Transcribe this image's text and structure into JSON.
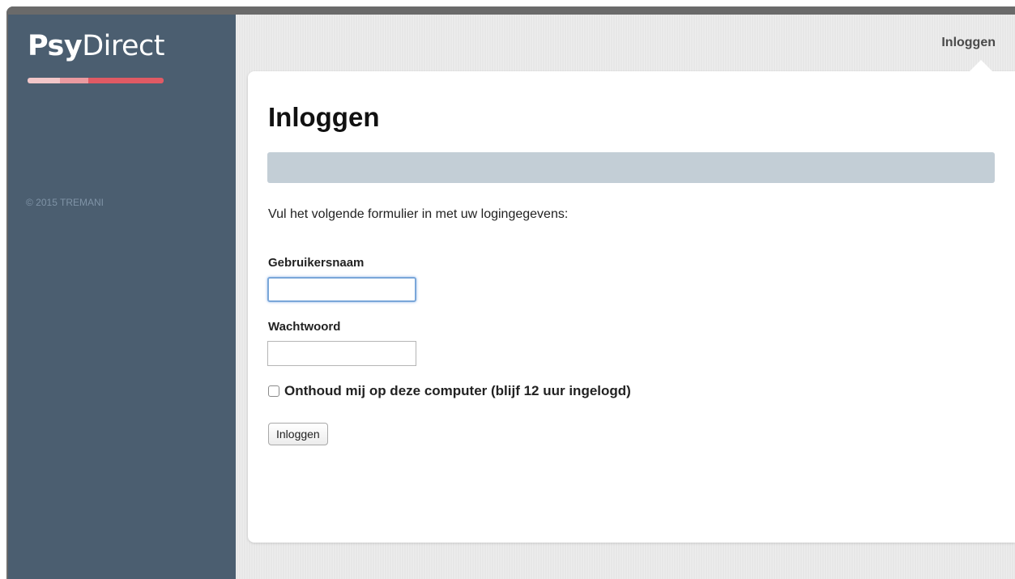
{
  "sidebar": {
    "logo_primary": "Psy",
    "logo_secondary": "Direct",
    "copyright": "© 2015 TREMANI"
  },
  "header": {
    "login_link": "Inloggen"
  },
  "login_form": {
    "title": "Inloggen",
    "intro": "Vul het volgende formulier in met uw logingegevens:",
    "username_label": "Gebruikersnaam",
    "username_value": "",
    "password_label": "Wachtwoord",
    "password_value": "",
    "remember_label": "Onthoud mij op deze computer (blijf 12 uur ingelogd)",
    "remember_checked": false,
    "submit_label": "Inloggen"
  },
  "colors": {
    "sidebar": "#4b5e70",
    "logo_accent": "#e05a64",
    "info_bar": "#c3ced6",
    "focus_ring": "#7aa7d9"
  },
  "icons": {
    "logo_underline": "logo-underline-bar",
    "remember_checkbox": "checkbox-unchecked"
  }
}
